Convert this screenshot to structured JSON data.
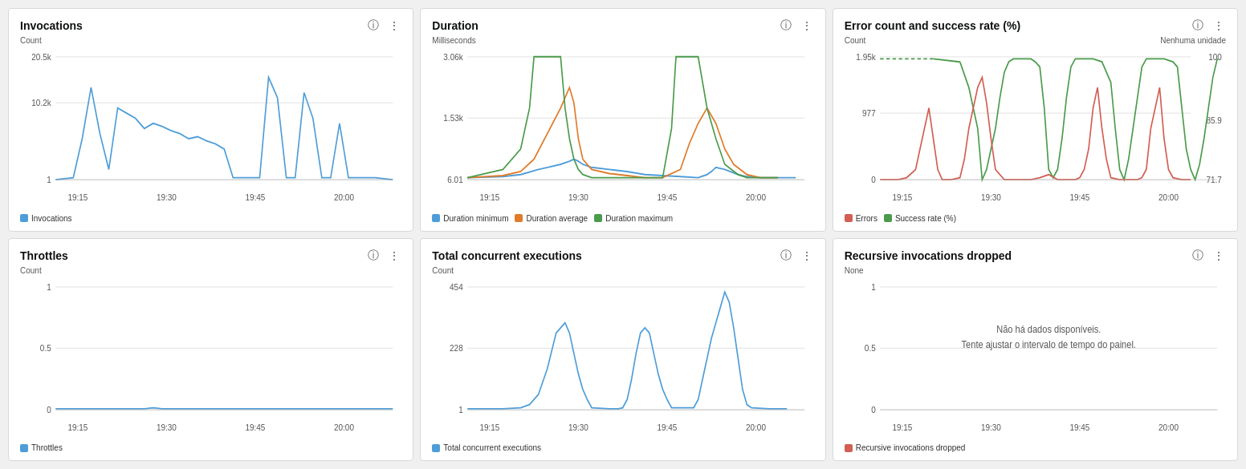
{
  "widgets": [
    {
      "id": "invocations",
      "title": "Invocations",
      "yAxisLabel": "Count",
      "yTicks": [
        "20.5k",
        "10.2k",
        "1"
      ],
      "xTicks": [
        "19:15",
        "19:30",
        "19:45",
        "20:00"
      ],
      "legend": [
        {
          "label": "Invocations",
          "color": "#4e9dd8"
        }
      ],
      "infoIcon": "ℹ",
      "menuIcon": "⋮"
    },
    {
      "id": "duration",
      "title": "Duration",
      "yAxisLabel": "Milliseconds",
      "yTicks": [
        "3.06k",
        "1.53k",
        "6.01"
      ],
      "xTicks": [
        "19:15",
        "19:30",
        "19:45",
        "20:00"
      ],
      "legend": [
        {
          "label": "Duration minimum",
          "color": "#4e9dd8"
        },
        {
          "label": "Duration average",
          "color": "#e07b29"
        },
        {
          "label": "Duration maximum",
          "color": "#4a9b4a"
        }
      ],
      "infoIcon": "ℹ",
      "menuIcon": "⋮"
    },
    {
      "id": "error-count",
      "title": "Error count and success rate (%)",
      "yAxisLabel": "Count",
      "yAxisLabelRight": "Nenhuma unidade",
      "yTicks": [
        "1.95k",
        "977",
        "0"
      ],
      "yTicksRight": [
        "100",
        "85.9",
        "71.7"
      ],
      "xTicks": [
        "19:15",
        "19:30",
        "19:45",
        "20:00"
      ],
      "legend": [
        {
          "label": "Errors",
          "color": "#d35e52"
        },
        {
          "label": "Success rate (%)",
          "color": "#4a9b4a"
        }
      ],
      "infoIcon": "ℹ",
      "menuIcon": "⋮"
    },
    {
      "id": "throttles",
      "title": "Throttles",
      "yAxisLabel": "Count",
      "yTicks": [
        "1",
        "0.5",
        "0"
      ],
      "xTicks": [
        "19:15",
        "19:30",
        "19:45",
        "20:00"
      ],
      "legend": [
        {
          "label": "Throttles",
          "color": "#4e9dd8"
        }
      ],
      "infoIcon": "ℹ",
      "menuIcon": "⋮"
    },
    {
      "id": "concurrent",
      "title": "Total concurrent executions",
      "yAxisLabel": "Count",
      "yTicks": [
        "454",
        "228",
        "1"
      ],
      "xTicks": [
        "19:15",
        "19:30",
        "19:45",
        "20:00"
      ],
      "legend": [
        {
          "label": "Total concurrent executions",
          "color": "#4e9dd8"
        }
      ],
      "infoIcon": "ℹ",
      "menuIcon": "⋮"
    },
    {
      "id": "recursive",
      "title": "Recursive invocations dropped",
      "yAxisLabel": "None",
      "yTicks": [
        "1",
        "0.5",
        "0"
      ],
      "xTicks": [
        "19:15",
        "19:30",
        "19:45",
        "20:00"
      ],
      "noData": true,
      "noDataText": "Não há dados disponíveis.\nTente ajustar o intervalo de tempo do painel.",
      "legend": [
        {
          "label": "Recursive invocations dropped",
          "color": "#d35e52"
        }
      ],
      "infoIcon": "ℹ",
      "menuIcon": "⋮"
    }
  ]
}
